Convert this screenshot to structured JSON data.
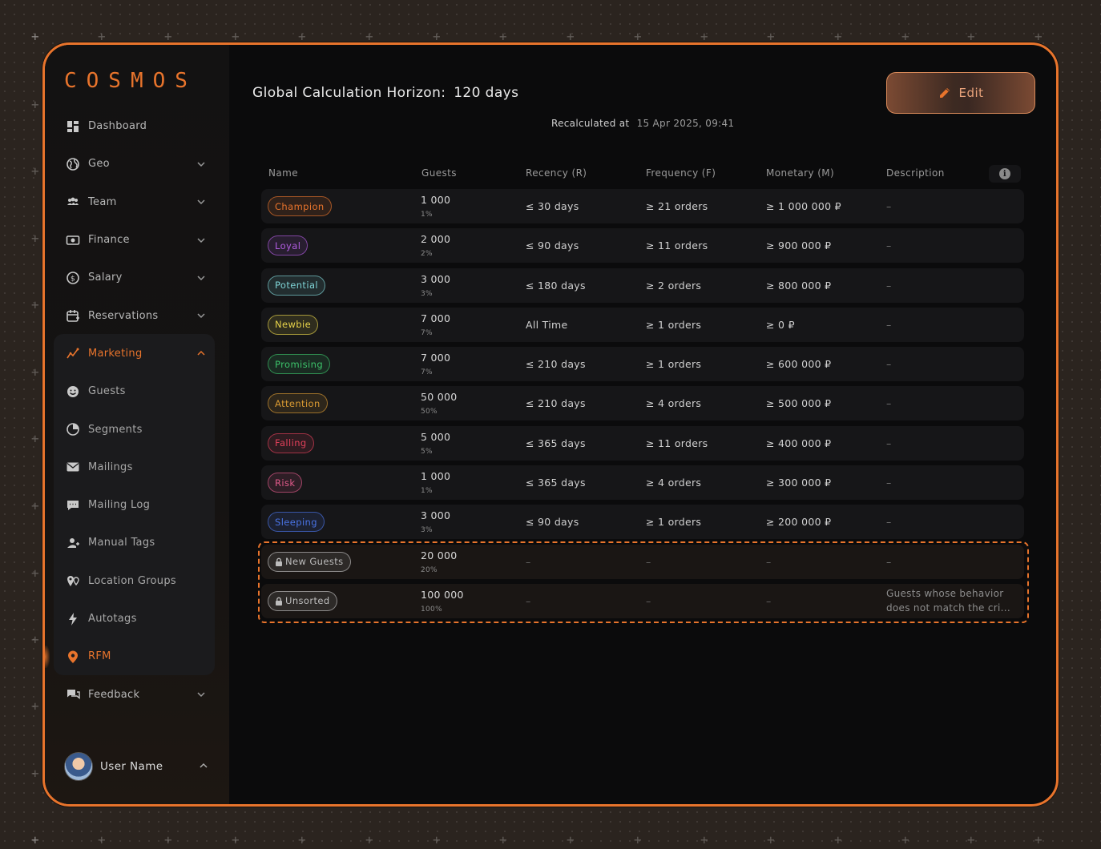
{
  "app": {
    "logo": "COSMOS"
  },
  "colors": {
    "accent": "#e8742c",
    "background": "#0b0b0c"
  },
  "sidebar": {
    "items": [
      {
        "label": "Dashboard",
        "icon": "dashboard-icon",
        "expandable": false
      },
      {
        "label": "Geo",
        "icon": "globe-icon",
        "expandable": true
      },
      {
        "label": "Team",
        "icon": "team-icon",
        "expandable": true
      },
      {
        "label": "Finance",
        "icon": "banknote-icon",
        "expandable": true
      },
      {
        "label": "Salary",
        "icon": "dollar-coin-icon",
        "expandable": true
      },
      {
        "label": "Reservations",
        "icon": "calendar-plus-icon",
        "expandable": true
      },
      {
        "label": "Marketing",
        "icon": "trend-chart-icon",
        "expandable": true,
        "expanded": true
      },
      {
        "label": "Guests",
        "icon": "smile-icon"
      },
      {
        "label": "Segments",
        "icon": "pie-icon"
      },
      {
        "label": "Mailings",
        "icon": "mail-icon"
      },
      {
        "label": "Mailing Log",
        "icon": "chat-log-icon"
      },
      {
        "label": "Manual Tags",
        "icon": "tag-user-icon"
      },
      {
        "label": "Location Groups",
        "icon": "location-group-icon"
      },
      {
        "label": "Autotags",
        "icon": "lightning-icon"
      },
      {
        "label": "RFM",
        "icon": "rfm-pin-icon",
        "current": true
      },
      {
        "label": "Feedback",
        "icon": "feedback-icon",
        "expandable": true
      }
    ],
    "user": {
      "name": "User Name"
    }
  },
  "header": {
    "horizon_label": "Global Calculation Horizon:",
    "horizon_value": "120 days",
    "edit_label": "Edit",
    "recalc_label": "Recalculated at",
    "recalc_value": "15 Apr 2025, 09:41"
  },
  "table": {
    "columns": [
      "Name",
      "Guests",
      "Recency (R)",
      "Frequency (F)",
      "Monetary (M)",
      "Description"
    ],
    "rows": [
      {
        "name": "Champion",
        "color": "#e8742c",
        "guests": "1 000",
        "pct": "1%",
        "recency": "≤ 30 days",
        "frequency": "≥ 21 orders",
        "monetary": "≥ 1 000 000 ₽",
        "description": "–"
      },
      {
        "name": "Loyal",
        "color": "#b05ce0",
        "guests": "2 000",
        "pct": "2%",
        "recency": "≤ 90 days",
        "frequency": "≥ 11 orders",
        "monetary": "≥ 900 000 ₽",
        "description": "–"
      },
      {
        "name": "Potential",
        "color": "#7fd4d6",
        "guests": "3 000",
        "pct": "3%",
        "recency": "≤ 180 days",
        "frequency": "≥ 2 orders",
        "monetary": "≥ 800 000 ₽",
        "description": "–"
      },
      {
        "name": "Newbie",
        "color": "#e6d24a",
        "guests": "7 000",
        "pct": "7%",
        "recency": "All Time",
        "frequency": "≥ 1 orders",
        "monetary": "≥ 0 ₽",
        "description": "–"
      },
      {
        "name": "Promising",
        "color": "#3cc26a",
        "guests": "7 000",
        "pct": "7%",
        "recency": "≤ 210 days",
        "frequency": "≥ 1 orders",
        "monetary": "≥ 600 000 ₽",
        "description": "–"
      },
      {
        "name": "Attention",
        "color": "#d99a32",
        "guests": "50 000",
        "pct": "50%",
        "recency": "≤ 210 days",
        "frequency": "≥ 4 orders",
        "monetary": "≥ 500 000 ₽",
        "description": "–"
      },
      {
        "name": "Falling",
        "color": "#e2405a",
        "guests": "5 000",
        "pct": "5%",
        "recency": "≤ 365 days",
        "frequency": "≥ 11 orders",
        "monetary": "≥ 400 000 ₽",
        "description": "–"
      },
      {
        "name": "Risk",
        "color": "#e05a8a",
        "guests": "1 000",
        "pct": "1%",
        "recency": "≤ 365 days",
        "frequency": "≥ 4 orders",
        "monetary": "≥ 300 000 ₽",
        "description": "–"
      },
      {
        "name": "Sleeping",
        "color": "#4a74e6",
        "guests": "3 000",
        "pct": "3%",
        "recency": "≤ 90 days",
        "frequency": "≥ 1 orders",
        "monetary": "≥ 200 000 ₽",
        "description": "–"
      }
    ],
    "fixed_rows": [
      {
        "name": "New Guests",
        "color": "#bdbdbd",
        "guests": "20 000",
        "pct": "20%",
        "recency": "–",
        "frequency": "–",
        "monetary": "–",
        "description": "–"
      },
      {
        "name": "Unsorted",
        "color": "#bdbdbd",
        "guests": "100 000",
        "pct": "100%",
        "recency": "–",
        "frequency": "–",
        "monetary": "–",
        "description": "Guests whose behavior does not match the cri..."
      }
    ]
  }
}
